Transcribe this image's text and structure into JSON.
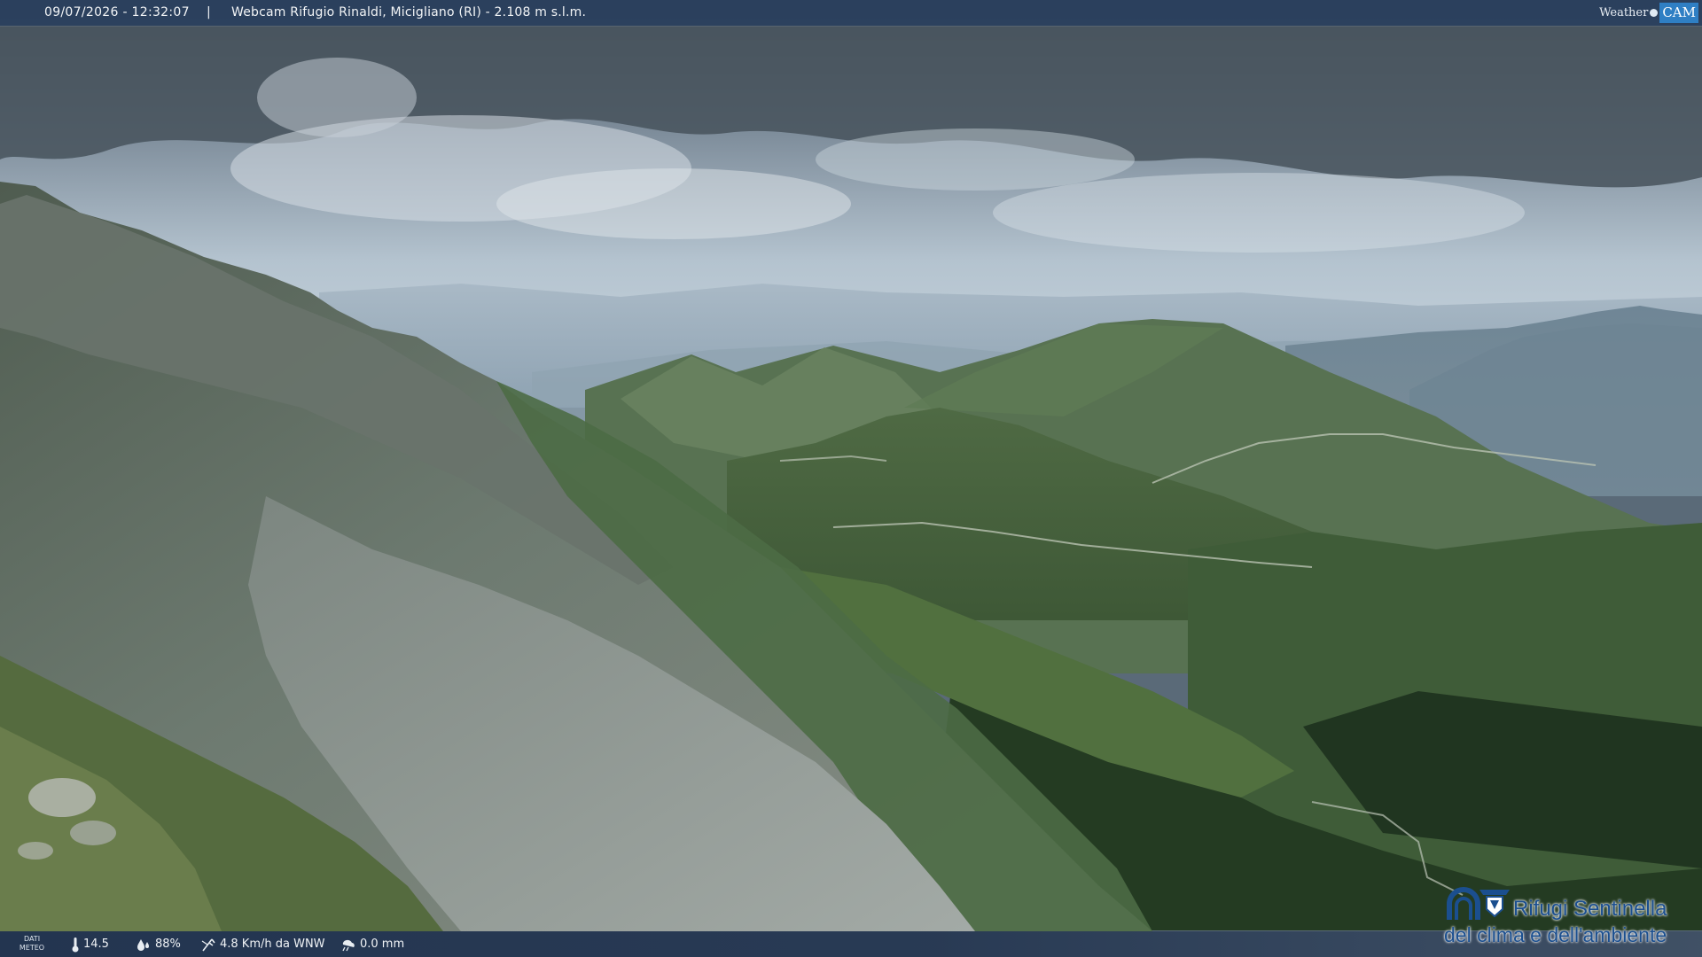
{
  "header": {
    "datetime": "09/07/2026 - 12:32:07",
    "separator": "|",
    "title": "Webcam Rifugio Rinaldi, Micigliano (RI) - 2.108 m s.l.m.",
    "brand_weather": "Weather",
    "brand_cam": "CAM"
  },
  "weather": {
    "label_line1": "DATI",
    "label_line2": "METEO",
    "temperature": "14.5",
    "humidity": "88%",
    "wind": "4.8 Km/h da WNW",
    "rain": "0.0 mm"
  },
  "logo": {
    "name": "Rifugi Sentinella",
    "tagline": "del clima e dell'ambiente"
  },
  "icons": {
    "temperature": "thermometer-icon",
    "humidity": "droplet-icon",
    "wind": "wind-icon",
    "rain": "rain-icon",
    "logo": "rifugi-sentinella-logo-icon"
  },
  "colors": {
    "bar": "#283e5c",
    "logo_blue": "#1b4f8f",
    "brand_cam": "#2f7fc4"
  }
}
